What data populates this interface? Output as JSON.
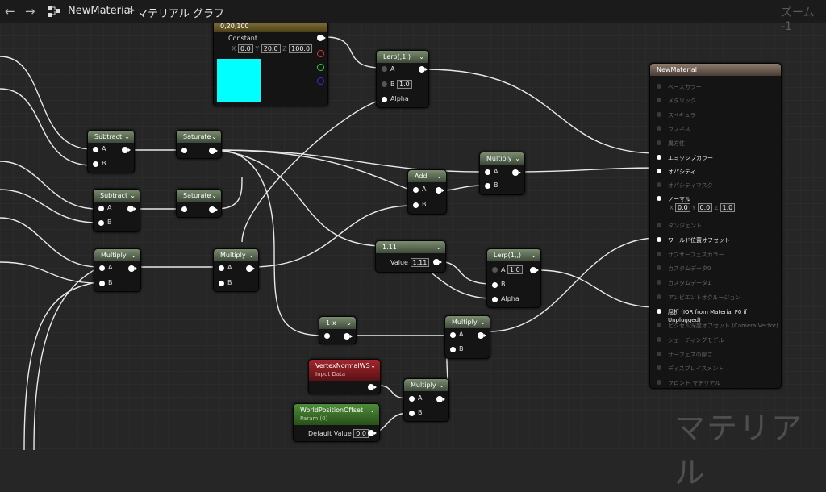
{
  "topbar": {
    "back_icon": "arrow-left-icon",
    "forward_icon": "arrow-right-icon",
    "graph_icon": "graph-icon",
    "asset": "NewMaterial",
    "separator": ">",
    "graph": "マテリアル グラフ",
    "zoom": "ズーム -1"
  },
  "watermark": "マテリアル",
  "const_node": {
    "title": "0,20,100",
    "name": "Constant",
    "x_label": "X",
    "x": "0.0",
    "y_label": "Y",
    "y": "20.0",
    "z_label": "Z",
    "z": "100.0",
    "preview_color": "#00ffff"
  },
  "lerp1": {
    "title": "Lerp(,1,)",
    "a": "A",
    "b": "B",
    "b_val": "1.0",
    "alpha": "Alpha"
  },
  "sub1": {
    "title": "Subtract",
    "a": "A",
    "b": "B"
  },
  "sub2": {
    "title": "Subtract",
    "a": "A",
    "b": "B"
  },
  "sat1": {
    "title": "Saturate"
  },
  "sat2": {
    "title": "Saturate"
  },
  "add": {
    "title": "Add",
    "a": "A",
    "b": "B"
  },
  "mul1": {
    "title": "Multiply",
    "a": "A",
    "b": "B"
  },
  "mul2": {
    "title": "Multiply",
    "a": "A",
    "b": "B"
  },
  "mul3": {
    "title": "Multiply",
    "a": "A",
    "b": "B"
  },
  "mul4": {
    "title": "Multiply",
    "a": "A",
    "b": "B"
  },
  "mul5": {
    "title": "Multiply",
    "a": "A",
    "b": "B"
  },
  "c111": {
    "title": "1.11",
    "value_label": "Value",
    "value": "1.11"
  },
  "lerp2": {
    "title": "Lerp(1,,)",
    "a": "A",
    "a_val": "1.0",
    "b": "B",
    "alpha": "Alpha"
  },
  "onex": {
    "title": "1-x"
  },
  "vnws": {
    "title": "VertexNormalWS",
    "subtitle": "Input Data"
  },
  "wpo": {
    "title": "WorldPositionOffset",
    "subtitle": "Param (0)",
    "default_label": "Default Value",
    "default_val": "0.0"
  },
  "material": {
    "title": "NewMaterial",
    "pins": [
      "ベースカラー",
      "メタリック",
      "スペキュラ",
      "ラフネス",
      "異方性",
      "エミッシブカラー",
      "オパシティ",
      "オパシティマスク",
      "ノーマル",
      "タンジェント",
      "ワールド位置オフセット",
      "サブサーフェスカラー",
      "カスタムデータ0",
      "カスタムデータ1",
      "アンビエントオクルージョン",
      "屈折 (IOR from Material F0 if Unplugged)",
      "ピクセル深度オフセット (Camera Vector)",
      "シェーディングモデル",
      "サーフェスの厚さ",
      "ディスプレイスメント",
      "フロント マテリアル"
    ],
    "normal_x_label": "X",
    "normal_x": "0.0",
    "normal_y_label": "Y",
    "normal_y": "0.0",
    "normal_z_label": "Z",
    "normal_z": "1.0"
  }
}
